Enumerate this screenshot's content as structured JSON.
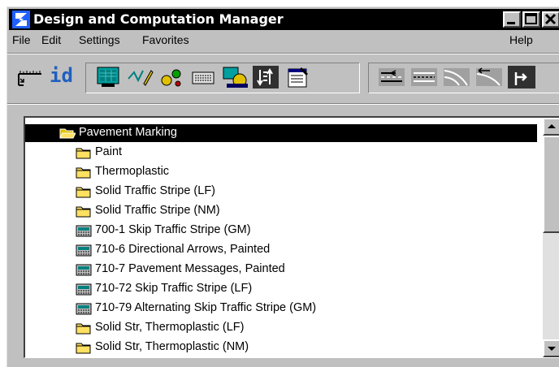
{
  "window": {
    "title": "Design and Computation Manager"
  },
  "menu": {
    "file": "File",
    "edit": "Edit",
    "settings": "Settings",
    "favorites": "Favorites",
    "help": "Help"
  },
  "toolbar": {
    "id_label": "id"
  },
  "tree": {
    "root": "Pavement Marking",
    "items": [
      {
        "label": "Paint",
        "icon": "folder-icon"
      },
      {
        "label": "Thermoplastic",
        "icon": "folder-icon"
      },
      {
        "label": "Solid Traffic Stripe (LF)",
        "icon": "folder-icon"
      },
      {
        "label": "Solid Traffic Stripe (NM)",
        "icon": "folder-icon"
      },
      {
        "label": "700-1 Skip Traffic Stripe (GM)",
        "icon": "keypad-icon"
      },
      {
        "label": "710-6 Directional Arrows, Painted",
        "icon": "keypad-icon"
      },
      {
        "label": "710-7 Pavement Messages, Painted",
        "icon": "keypad-icon"
      },
      {
        "label": "710-72 Skip Traffic Stripe (LF)",
        "icon": "keypad-icon"
      },
      {
        "label": "710-79 Alternating Skip Traffic Stripe (GM)",
        "icon": "keypad-icon"
      },
      {
        "label": "Solid Str, Thermoplastic (LF)",
        "icon": "folder-icon"
      },
      {
        "label": "Solid Str, Thermoplastic (NM)",
        "icon": "folder-icon"
      }
    ]
  }
}
